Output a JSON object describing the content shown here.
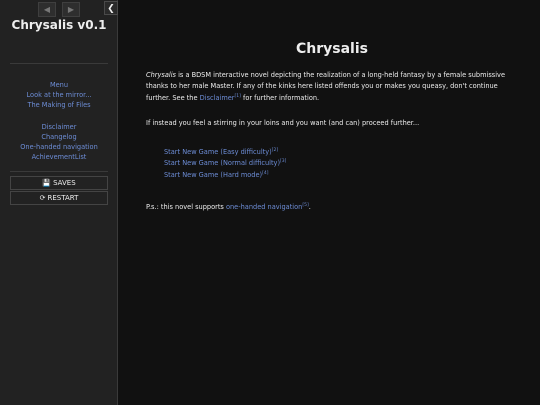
{
  "sidebar": {
    "history_back_icon": "left-arrow-icon",
    "history_forward_icon": "right-arrow-icon",
    "stow_icon": "chevron-left-icon",
    "title": "Chrysalis v0.1",
    "menu": {
      "group1": [
        "Menu",
        "Look at the mirror...",
        "The Making of Files"
      ],
      "group2": [
        "Disclaimer",
        "Changelog",
        "One-handed navigation",
        "AchievementList"
      ]
    },
    "saves_label": "SAVES",
    "saves_icon": "floppy-disk-icon",
    "restart_label": "RESTART",
    "restart_icon": "restart-icon"
  },
  "passage": {
    "title": "Chrysalis",
    "intro": {
      "italic": "Chrysalis",
      "text": " is a BDSM interactive novel depicting the realization of a long-held fantasy by a female submissive thanks to her male Master. If any of the kinks here listed offends you or makes you queasy, don't continue further. See the ",
      "link": "Disclaimer",
      "link_note": "[1]",
      "after": " for further information."
    },
    "stirring": "If instead you feel a stirring in your loins and you want (and can) proceed further...",
    "start_links": [
      {
        "label": "Start New Game (Easy difficulty)",
        "note": "[2]"
      },
      {
        "label": "Start New Game (Normal difficulty)",
        "note": "[3]"
      },
      {
        "label": "Start New Game (Hard mode)",
        "note": "[4]"
      }
    ],
    "ps": {
      "before": "P.s.: this novel supports ",
      "link": "one-handed navigation",
      "note": "[5]",
      "after": "."
    }
  },
  "colors": {
    "background": "#111111",
    "sidebar": "#222222",
    "link": "#6d8dd6",
    "text": "#eeeeee"
  }
}
